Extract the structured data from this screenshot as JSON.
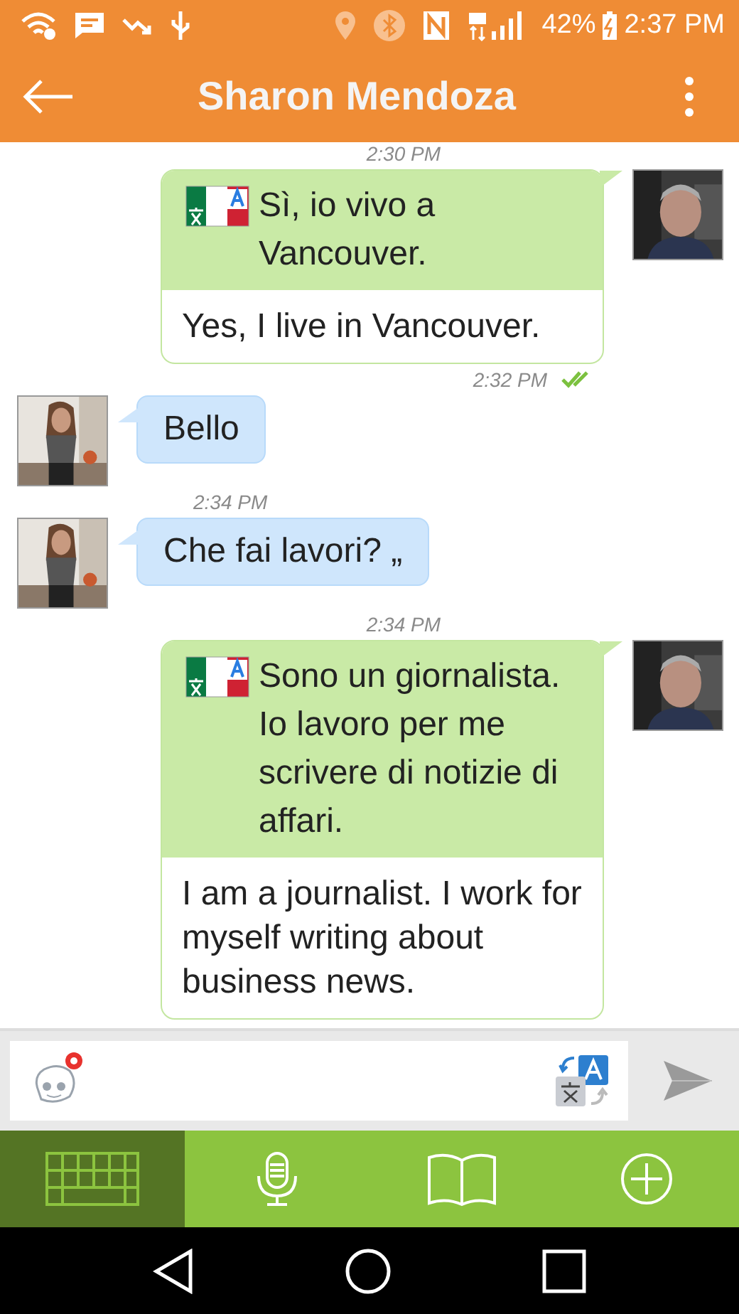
{
  "status_bar": {
    "battery": "42%",
    "time": "2:37 PM"
  },
  "header": {
    "title": "Sharon Mendoza"
  },
  "messages": [
    {
      "kind": "sent_time",
      "text": "2:30 PM",
      "read": false
    },
    {
      "kind": "outgoing",
      "original": "Sì, io vivo a Vancouver.",
      "translation": "Yes, I live in Vancouver."
    },
    {
      "kind": "sent_time",
      "text": "2:32 PM",
      "read": true
    },
    {
      "kind": "incoming",
      "text": "Bello"
    },
    {
      "kind": "received_time",
      "text": "2:34 PM",
      "read": false
    },
    {
      "kind": "incoming",
      "text": "Che fai lavori? „"
    },
    {
      "kind": "sent_time",
      "text": "2:34 PM",
      "read": false
    },
    {
      "kind": "outgoing",
      "original": "Sono un giornalista. Io lavoro per me scrivere di notizie di affari.",
      "translation": "I am a journalist. I work for myself writing about business news."
    }
  ],
  "toolbar": [
    {
      "kind": "keyboard",
      "selected": true
    },
    {
      "kind": "microphone",
      "selected": false
    },
    {
      "kind": "book",
      "selected": false
    },
    {
      "kind": "plus",
      "selected": false
    }
  ]
}
